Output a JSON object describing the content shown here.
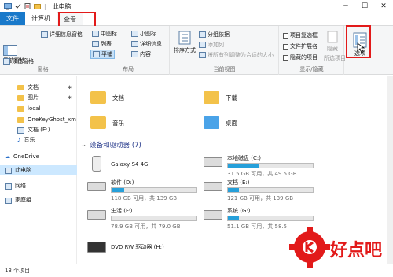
{
  "window": {
    "title": "此电脑",
    "qa_separator": "|"
  },
  "tabs": [
    {
      "label": "文件"
    },
    {
      "label": "计算机"
    },
    {
      "label": "查看"
    }
  ],
  "ribbon": {
    "pane_group": {
      "label": "窗格",
      "nav_pane": "导航窗格",
      "preview_pane": "预览窗格",
      "details_pane": "详细信息窗格"
    },
    "layout_group": {
      "label": "布局",
      "items": [
        "中图标",
        "小图标",
        "列表",
        "详细信息",
        "平铺",
        "内容"
      ]
    },
    "current_view_group": {
      "label": "当前视图",
      "sort_by": "排序方式",
      "group_by": "分组依据",
      "add_column": "添加列",
      "size_all_columns": "将所有列调整为合适的大小"
    },
    "show_hide_group": {
      "label": "显示/隐藏",
      "item_checkboxes": "项目复选框",
      "file_extensions": "文件扩展名",
      "hidden_items": "隐藏的项目",
      "hide": "隐藏",
      "selected_items": "所选项目"
    },
    "options_label": "选项"
  },
  "nav": {
    "items": [
      {
        "label": "文档",
        "pinned": true
      },
      {
        "label": "图片",
        "pinned": true
      },
      {
        "label": "local"
      },
      {
        "label": "OneKeyGhost_xm"
      },
      {
        "label": "文档 (E:)"
      },
      {
        "label": "音乐"
      },
      {
        "label": "OneDrive"
      },
      {
        "label": "此电脑",
        "selected": true
      },
      {
        "label": "网络"
      },
      {
        "label": "家庭组"
      }
    ]
  },
  "content": {
    "libraries": [
      {
        "label": "文档"
      },
      {
        "label": "下载"
      },
      {
        "label": "音乐"
      },
      {
        "label": "桌面"
      }
    ],
    "devices_header": "设备和驱动器 (7)",
    "drives": [
      {
        "name": "Galaxy S4 4G",
        "sub": "",
        "used_fraction": null
      },
      {
        "name": "本地磁盘 (C:)",
        "sub": "31.5 GB 可用，共 49.5 GB",
        "used_fraction": 0.36
      },
      {
        "name": "软件 (D:)",
        "sub": "118 GB 可用，共 139 GB",
        "used_fraction": 0.15
      },
      {
        "name": "文档 (E:)",
        "sub": "121 GB 可用，共 139 GB",
        "used_fraction": 0.13
      },
      {
        "name": "生活 (F:)",
        "sub": "78.9 GB 可用，共 79.0 GB",
        "used_fraction": 0.01
      },
      {
        "name": "系统 (G:)",
        "sub": "51.1 GB 可用，共 58.5",
        "used_fraction": 0.13
      },
      {
        "name": "DVD RW 驱动器 (H:)",
        "sub": "",
        "used_fraction": null
      }
    ]
  },
  "status": {
    "count": "13 个项目"
  },
  "watermark": {
    "text": "好点吧"
  },
  "colors": {
    "accent": "#1979ca",
    "highlight_box": "#e21a1a",
    "bar_fill": "#26a0da",
    "selection": "#cce8ff"
  }
}
